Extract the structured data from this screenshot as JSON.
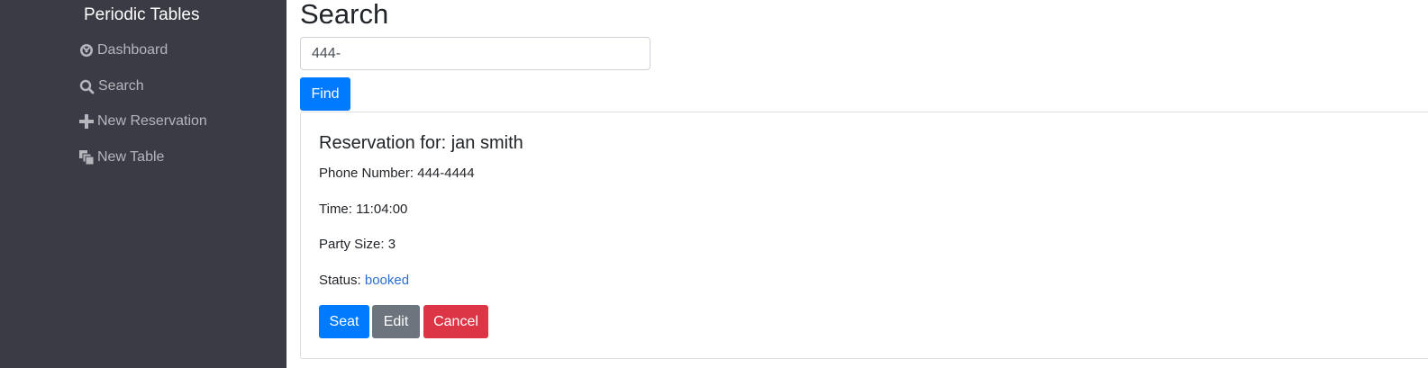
{
  "sidebar": {
    "brand": "Periodic Tables",
    "items": [
      {
        "label": "Dashboard",
        "icon": "dashboard-icon"
      },
      {
        "label": "Search",
        "icon": "search-icon"
      },
      {
        "label": "New Reservation",
        "icon": "plus-icon"
      },
      {
        "label": "New Table",
        "icon": "layers-icon"
      }
    ]
  },
  "main": {
    "title": "Search",
    "search": {
      "value": "444-"
    },
    "find_label": "Find"
  },
  "reservation": {
    "title": "Reservation for: jan smith",
    "phone": "Phone Number: 444-4444",
    "time": "Time: 11:04:00",
    "party_size": "Party Size: 3",
    "status_label": "Status:",
    "status_value": "booked",
    "buttons": {
      "seat": "Seat",
      "edit": "Edit",
      "cancel": "Cancel"
    }
  },
  "colors": {
    "sidebar_bg": "#3a3b45",
    "primary": "#007bff",
    "secondary": "#6c757d",
    "danger": "#dc3545",
    "status_link": "#2a6fd1"
  }
}
